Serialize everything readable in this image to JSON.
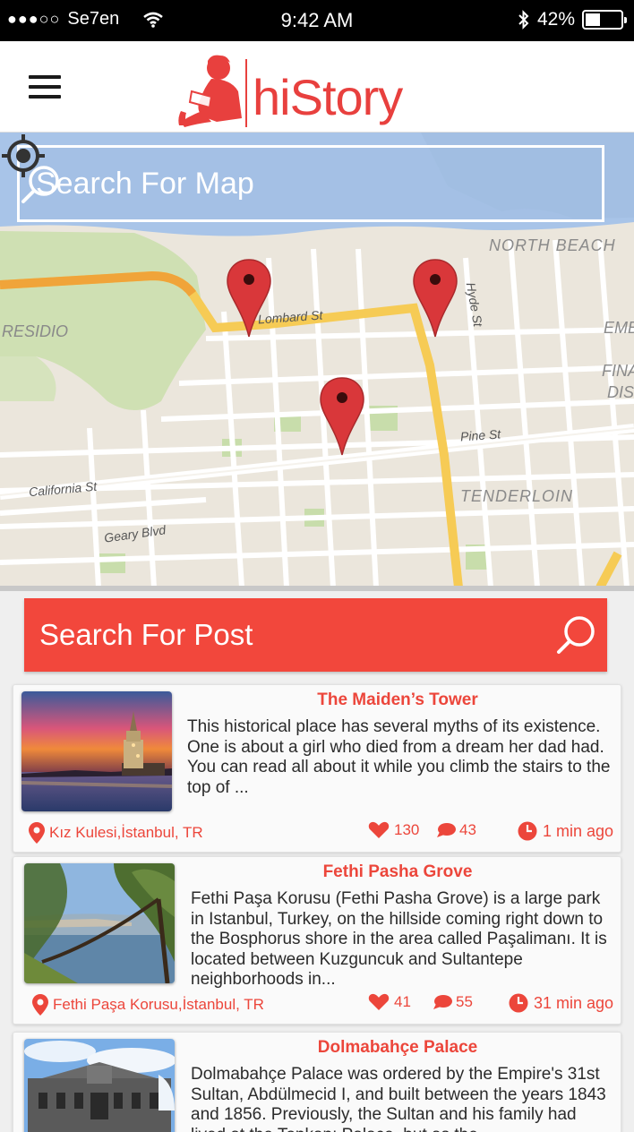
{
  "status_bar": {
    "carrier": "Se7en",
    "signal_dots": "●●●○○",
    "time": "9:42 AM",
    "battery": "42%",
    "battery_level": 0.42
  },
  "header": {
    "logo_text": "hiStory",
    "menu_icon": "hamburger-menu-icon"
  },
  "map": {
    "search_placeholder": "Search For Map",
    "labels": {
      "north_beach": "NORTH BEACH",
      "presidio": "RESIDIO",
      "lombard": "Lombard St",
      "hyde": "Hyde St",
      "emb": "EMB",
      "financial_1": "FINA",
      "financial_2": "DIS",
      "pine": "Pine St",
      "california": "California St",
      "tenderloin": "TENDERLOIN",
      "geary": "Geary Blvd"
    },
    "pin_color": "#d9373a"
  },
  "post_search": {
    "placeholder": "Search For Post"
  },
  "accent_color": "#ec463b",
  "posts": [
    {
      "title": "The Maiden’s Tower",
      "description": "This historical place has several myths of its existence. One is about a girl who died from a dream her dad had. You can read all about it while you climb the stairs to the top of ...",
      "location": "Kız Kulesi,İstanbul, TR",
      "likes": "130",
      "comments": "43",
      "time": "1 min ago"
    },
    {
      "title": "Fethi Pasha Grove",
      "description": "Fethi Paşa Korusu (Fethi Pasha Grove) is a large park in Istanbul, Turkey, on the hillside coming right down to the Bosphorus shore in the area called Paşalimanı. It is located between Kuzguncuk and Sultantepe neighborhoods in...",
      "location": "Fethi Paşa Korusu,İstanbul, TR",
      "likes": "41",
      "comments": "55",
      "time": "31 min ago"
    },
    {
      "title": "Dolmabahçe Palace",
      "description": "Dolmabahçe Palace was ordered by the Empire's 31st Sultan, Abdülmecid I, and built between the years 1843 and 1856. Previously, the Sultan and his family had lived at the Topkapı Palace, but as the"
    }
  ]
}
